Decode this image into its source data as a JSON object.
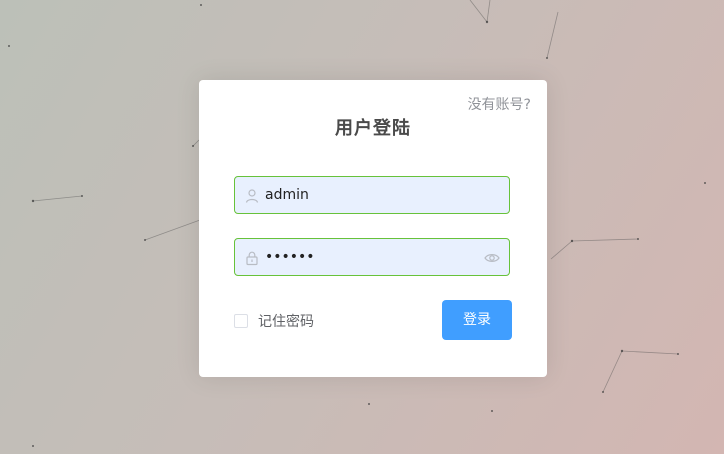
{
  "colors": {
    "accent": "#409eff",
    "valid_border": "#67c23a",
    "input_fill": "#e8f0fe"
  },
  "dialog": {
    "title": "用户登陆",
    "no_account_link": "没有账号?",
    "username": {
      "icon": "user-icon",
      "value": "admin"
    },
    "password": {
      "icon": "lock-icon",
      "value": "••••••",
      "toggle_icon": "eye-icon"
    },
    "remember_label": "记住密码",
    "remember_checked": false,
    "login_label": "登录"
  }
}
